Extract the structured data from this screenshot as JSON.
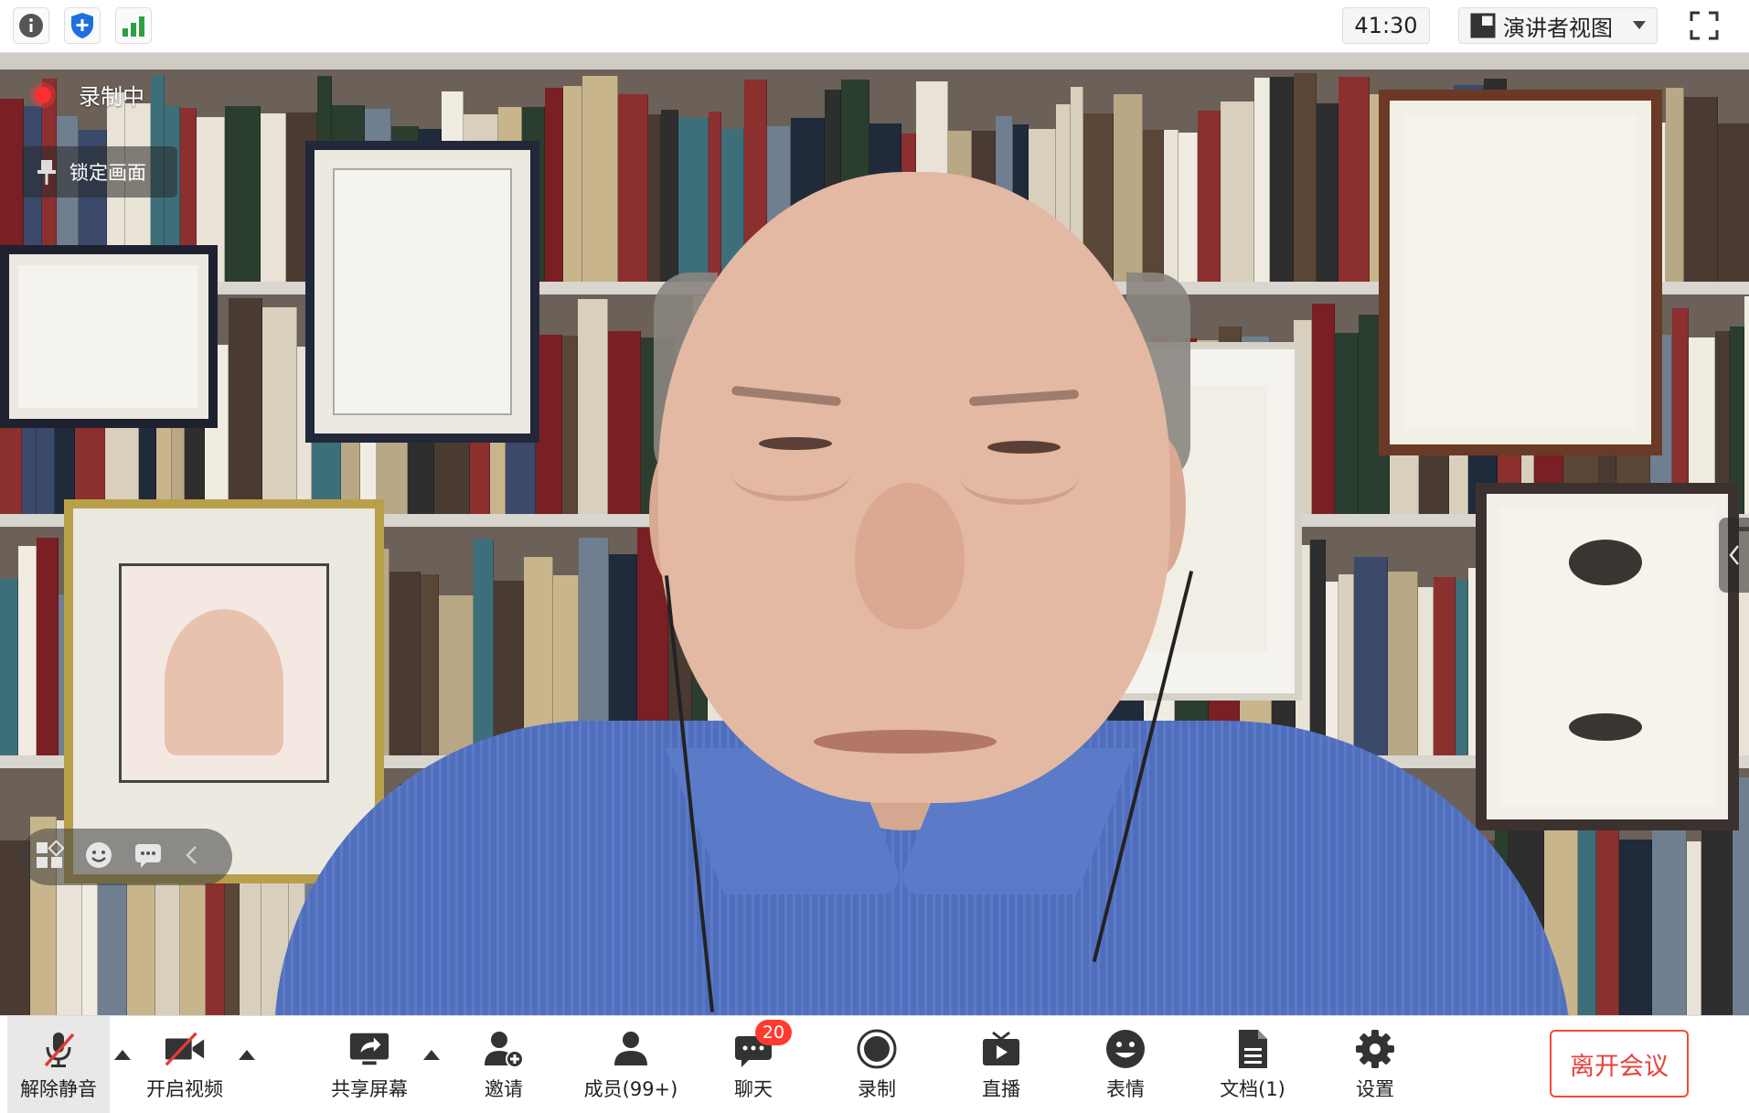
{
  "topbar": {
    "info_icon": "info-icon",
    "security_icon": "shield-plus-icon",
    "network_icon": "signal-bars-icon",
    "timer": "41:30",
    "view_mode": "演讲者视图",
    "fullscreen_icon": "fullscreen-icon"
  },
  "video": {
    "recording_label": "录制中",
    "lock_label": "锁定画面",
    "float_icons": [
      "layout-grid-icon",
      "emoji-icon",
      "chat-icon",
      "collapse-left-icon"
    ]
  },
  "toolbar": {
    "items": [
      {
        "label": "解除静音",
        "icon": "mic-off-icon"
      },
      {
        "label": "开启视频",
        "icon": "video-off-icon"
      },
      {
        "label": "共享屏幕",
        "icon": "share-screen-icon"
      },
      {
        "label": "邀请",
        "icon": "invite-user-icon"
      },
      {
        "label": "成员(99+)",
        "icon": "members-icon"
      },
      {
        "label": "聊天",
        "icon": "chat-icon",
        "badge": "20"
      },
      {
        "label": "录制",
        "icon": "record-icon"
      },
      {
        "label": "直播",
        "icon": "live-tv-icon"
      },
      {
        "label": "表情",
        "icon": "smiley-icon"
      },
      {
        "label": "文档(1)",
        "icon": "document-icon"
      },
      {
        "label": "设置",
        "icon": "gear-icon"
      }
    ],
    "leave_label": "离开会议"
  },
  "colors": {
    "recording_red": "#ff2d2d",
    "badge_red": "#ff3b30",
    "leave_red": "#e8413a",
    "signal_green": "#2ea043",
    "security_blue": "#1e6fe0"
  }
}
